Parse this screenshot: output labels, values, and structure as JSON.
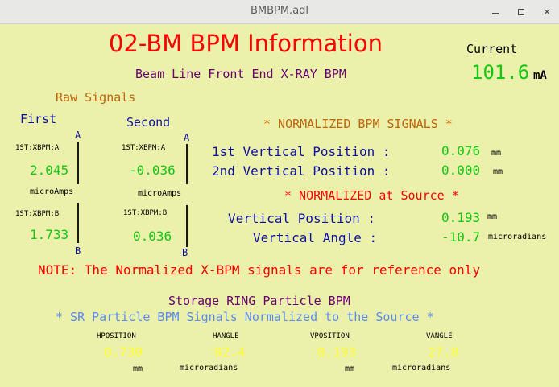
{
  "window": {
    "title": "BMBPM.adl"
  },
  "header": {
    "main_title": "02-BM BPM Information",
    "subtitle": "Beam Line Front End X-RAY BPM",
    "current_label": "Current",
    "current_value": "101.6",
    "current_unit": "mA"
  },
  "raw": {
    "heading": "Raw Signals",
    "first_heading": "First",
    "second_heading": "Second",
    "first": {
      "a_marker": "A",
      "b_marker": "B",
      "a_pv": "1ST:XBPM:A",
      "a_value": "2.045",
      "unit": "microAmps",
      "b_pv": "1ST:XBPM:B",
      "b_value": "1.733"
    },
    "second": {
      "a_marker": "A",
      "b_marker": "B",
      "a_pv": "1ST:XBPM:A",
      "a_value": "-0.036",
      "unit": "microAmps",
      "b_pv": "1ST:XBPM:B",
      "b_value": "0.036"
    }
  },
  "normalized": {
    "heading": "*  NORMALIZED BPM SIGNALS *",
    "pos1_label": "1st Vertical Position :",
    "pos1_value": "0.076",
    "pos1_unit": "mm",
    "pos2_label": "2nd Vertical Position :",
    "pos2_value": "0.000",
    "pos2_unit": "mm",
    "source_heading": "*  NORMALIZED at Source *",
    "vpos_label": "Vertical Position :",
    "vpos_value": "0.193",
    "vpos_unit": "mm",
    "vang_label": "Vertical Angle :",
    "vang_value": "-10.7",
    "vang_unit": "microradians"
  },
  "note": "NOTE:  The Normalized X-BPM signals are for reference only",
  "ring": {
    "heading": "Storage RING Particle BPM",
    "subheading": "* SR Particle BPM Signals Normalized to the Source *",
    "columns": [
      {
        "label": "HPOSITION",
        "value": "0.730",
        "unit": "mm"
      },
      {
        "label": "HANGLE",
        "value": "82.4",
        "unit": "microradians"
      },
      {
        "label": "VPOSITION",
        "value": "0.193",
        "unit": "mm"
      },
      {
        "label": "VANGLE",
        "value": "27.8",
        "unit": "microradians"
      }
    ]
  },
  "colors": {
    "title_red": "#ff0000",
    "subtitle_purple": "#6a0070",
    "heading_orange": "#c0650a",
    "label_blue": "#1010a0",
    "value_green": "#14c814",
    "value_yellow": "#ffff30",
    "sr_blue": "#5a8cf0",
    "background": "#ebf0ab"
  }
}
